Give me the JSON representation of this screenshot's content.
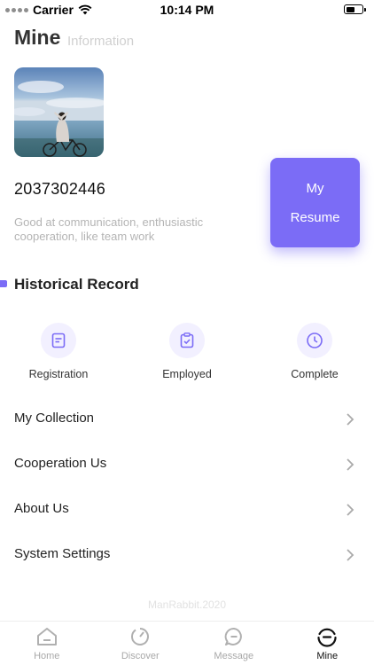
{
  "status_bar": {
    "carrier": "Carrier",
    "time": "10:14 PM",
    "battery_level": 0.55
  },
  "header": {
    "title": "Mine",
    "subtitle": "Information"
  },
  "profile": {
    "avatar_icon": "profile-photo",
    "user_id": "2037302446",
    "bio": "Good at communication, enthusiastic cooperation, like team work",
    "resume_line1": "My",
    "resume_line2": "Resume"
  },
  "history": {
    "title": "Historical Record",
    "items": [
      {
        "label": "Registration",
        "icon": "document-icon"
      },
      {
        "label": "Employed",
        "icon": "clipboard-check-icon"
      },
      {
        "label": "Complete",
        "icon": "clock-icon"
      }
    ]
  },
  "menu": {
    "items": [
      {
        "label": "My Collection"
      },
      {
        "label": "Cooperation Us"
      },
      {
        "label": "About Us"
      },
      {
        "label": "System Settings"
      }
    ]
  },
  "footer": {
    "note": "ManRabbit.2020"
  },
  "tabbar": {
    "items": [
      {
        "label": "Home",
        "icon": "home-icon"
      },
      {
        "label": "Discover",
        "icon": "discover-icon"
      },
      {
        "label": "Message",
        "icon": "message-icon"
      },
      {
        "label": "Mine",
        "icon": "mine-icon"
      }
    ],
    "active": "Mine"
  },
  "colors": {
    "accent": "#7b6cf6",
    "accent_light": "#f2f0ff",
    "muted_text": "#b4b4b4"
  }
}
